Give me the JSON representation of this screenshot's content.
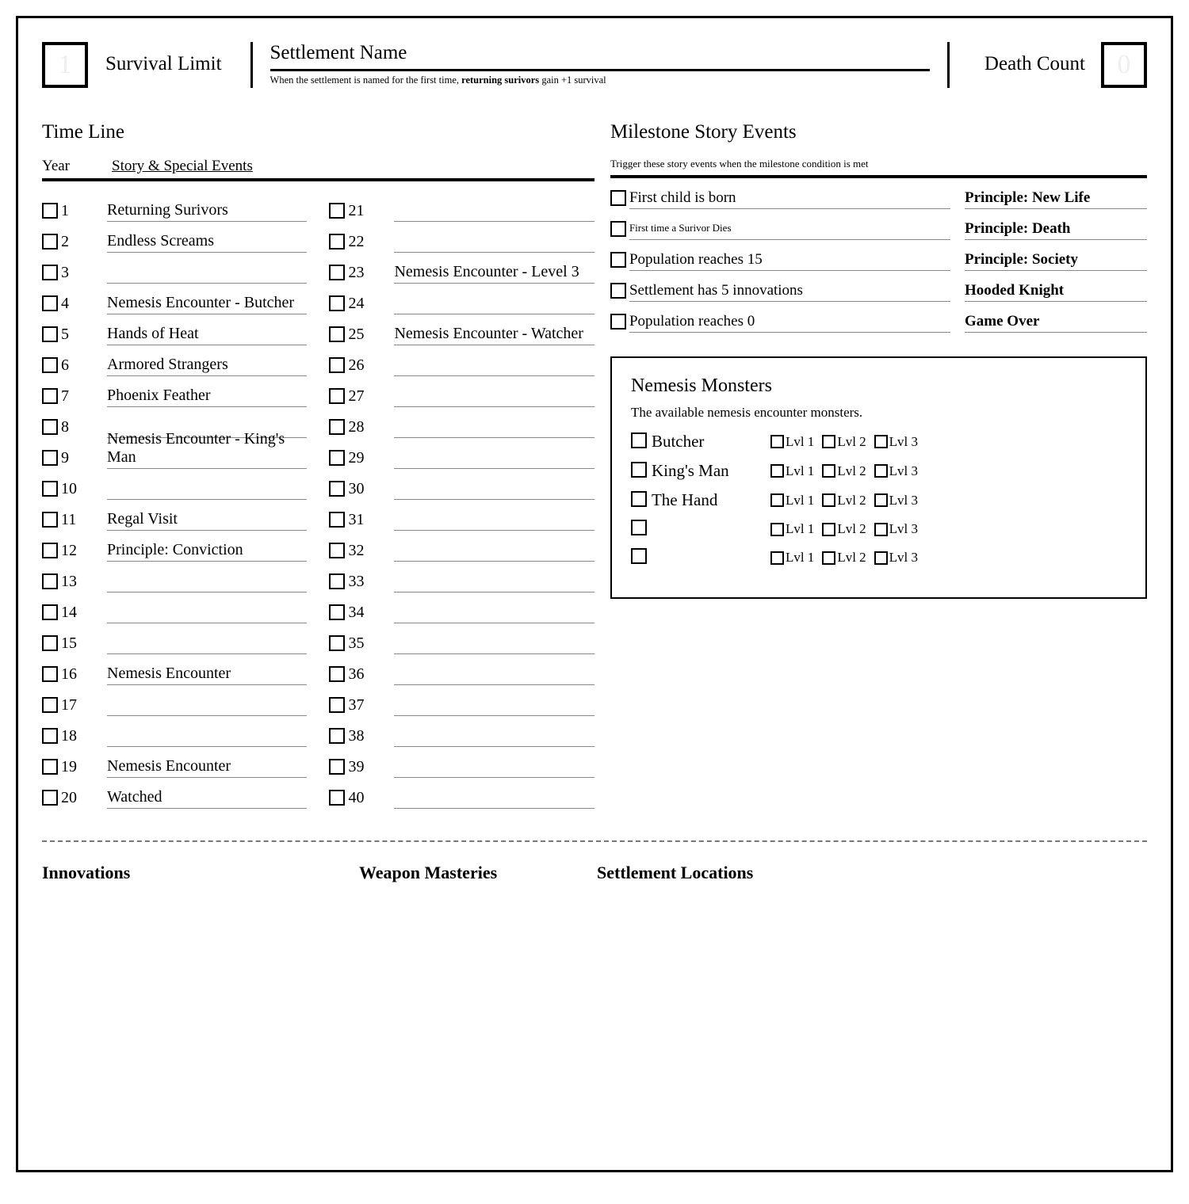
{
  "header": {
    "survival_limit_value": "1",
    "survival_limit_label": "Survival Limit",
    "settlement_name_label": "Settlement Name",
    "settlement_name_note_a": "When the settlement is named for the first time, ",
    "settlement_name_note_b": "returning surivors",
    "settlement_name_note_c": " gain +1 survival",
    "death_count_label": "Death Count",
    "death_count_value": "0"
  },
  "timeline": {
    "title": "Time Line",
    "col_year": "Year",
    "col_events": "Story & Special Events",
    "years": [
      {
        "y": "1",
        "e": "Returning Surivors"
      },
      {
        "y": "2",
        "e": "Endless Screams"
      },
      {
        "y": "3",
        "e": ""
      },
      {
        "y": "4",
        "e": "Nemesis Encounter - Butcher"
      },
      {
        "y": "5",
        "e": "Hands of Heat"
      },
      {
        "y": "6",
        "e": "Armored Strangers"
      },
      {
        "y": "7",
        "e": "Phoenix Feather"
      },
      {
        "y": "8",
        "e": ""
      },
      {
        "y": "9",
        "e": "Nemesis Encounter - King's Man"
      },
      {
        "y": "10",
        "e": ""
      },
      {
        "y": "11",
        "e": "Regal Visit"
      },
      {
        "y": "12",
        "e": "Principle: Conviction"
      },
      {
        "y": "13",
        "e": ""
      },
      {
        "y": "14",
        "e": ""
      },
      {
        "y": "15",
        "e": ""
      },
      {
        "y": "16",
        "e": "Nemesis Encounter"
      },
      {
        "y": "17",
        "e": ""
      },
      {
        "y": "18",
        "e": ""
      },
      {
        "y": "19",
        "e": "Nemesis Encounter"
      },
      {
        "y": "20",
        "e": "Watched"
      },
      {
        "y": "21",
        "e": ""
      },
      {
        "y": "22",
        "e": ""
      },
      {
        "y": "23",
        "e": "Nemesis Encounter - Level 3"
      },
      {
        "y": "24",
        "e": ""
      },
      {
        "y": "25",
        "e": "Nemesis Encounter - Watcher"
      },
      {
        "y": "26",
        "e": ""
      },
      {
        "y": "27",
        "e": ""
      },
      {
        "y": "28",
        "e": ""
      },
      {
        "y": "29",
        "e": ""
      },
      {
        "y": "30",
        "e": ""
      },
      {
        "y": "31",
        "e": ""
      },
      {
        "y": "32",
        "e": ""
      },
      {
        "y": "33",
        "e": ""
      },
      {
        "y": "34",
        "e": ""
      },
      {
        "y": "35",
        "e": ""
      },
      {
        "y": "36",
        "e": ""
      },
      {
        "y": "37",
        "e": ""
      },
      {
        "y": "38",
        "e": ""
      },
      {
        "y": "39",
        "e": ""
      },
      {
        "y": "40",
        "e": ""
      }
    ]
  },
  "milestones": {
    "title": "Milestone Story Events",
    "note": "Trigger these story events when the milestone condition is met",
    "rows": [
      {
        "cond": "First child is born",
        "res": "Principle: New Life",
        "small": false
      },
      {
        "cond": "First time a Surivor Dies",
        "res": "Principle: Death",
        "small": true
      },
      {
        "cond": "Population reaches 15",
        "res": "Principle: Society",
        "small": false
      },
      {
        "cond": "Settlement has 5 innovations",
        "res": "Hooded Knight",
        "small": false
      },
      {
        "cond": "Population reaches 0",
        "res": "Game Over",
        "small": false
      }
    ]
  },
  "nemesis": {
    "title": "Nemesis Monsters",
    "subtitle": "The available nemesis encounter monsters.",
    "lvl1": "Lvl 1",
    "lvl2": "Lvl 2",
    "lvl3": "Lvl 3",
    "monsters": [
      {
        "name": "Butcher"
      },
      {
        "name": "King's Man"
      },
      {
        "name": "The Hand"
      },
      {
        "name": ""
      },
      {
        "name": ""
      }
    ]
  },
  "bottom": {
    "innovations": "Innovations",
    "weapon": "Weapon Masteries",
    "locations": "Settlement Locations"
  }
}
